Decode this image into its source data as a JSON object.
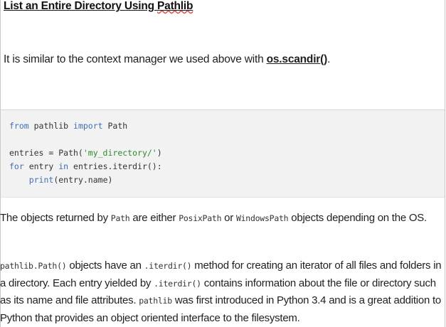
{
  "heading": {
    "pre": "List an Entire Directory Using ",
    "word": "Pathlib"
  },
  "intro": {
    "text": "It is similar to the context manager we used above with ",
    "code": "os.scandir()",
    "end": "."
  },
  "code": {
    "line1": {
      "kw1": "from",
      "mod": " pathlib ",
      "kw2": "import",
      "name": " Path"
    },
    "line2": {
      "pre": "entries = Path(",
      "str": "'my_directory/'",
      "post": ")"
    },
    "line3": {
      "kw1": "for",
      "mid": " entry ",
      "kw2": "in",
      "post": " entries.iterdir():"
    },
    "line4": {
      "indent": "    ",
      "kw": "print",
      "post": "(entry.name)"
    }
  },
  "para1": {
    "t1": "The objects returned by ",
    "c1": "Path",
    "t2": " are either ",
    "c2": "PosixPath",
    "t3": " or ",
    "c3": "WindowsPath",
    "t4": " objects depending on the OS."
  },
  "para2": {
    "c1": "pathlib.Path()",
    "t1": " objects have an ",
    "c2": ".iterdir()",
    "t2": " method for creating an iterator of all files and folders in a directory. Each entry yielded by ",
    "c3": ".iterdir()",
    "t3": " contains information about the file or directory such as its name and file attributes. ",
    "c4": "pathlib",
    "t4": " was first introduced in Python 3.4 and is a great addition to Python that provides an object oriented interface to the filesystem."
  }
}
